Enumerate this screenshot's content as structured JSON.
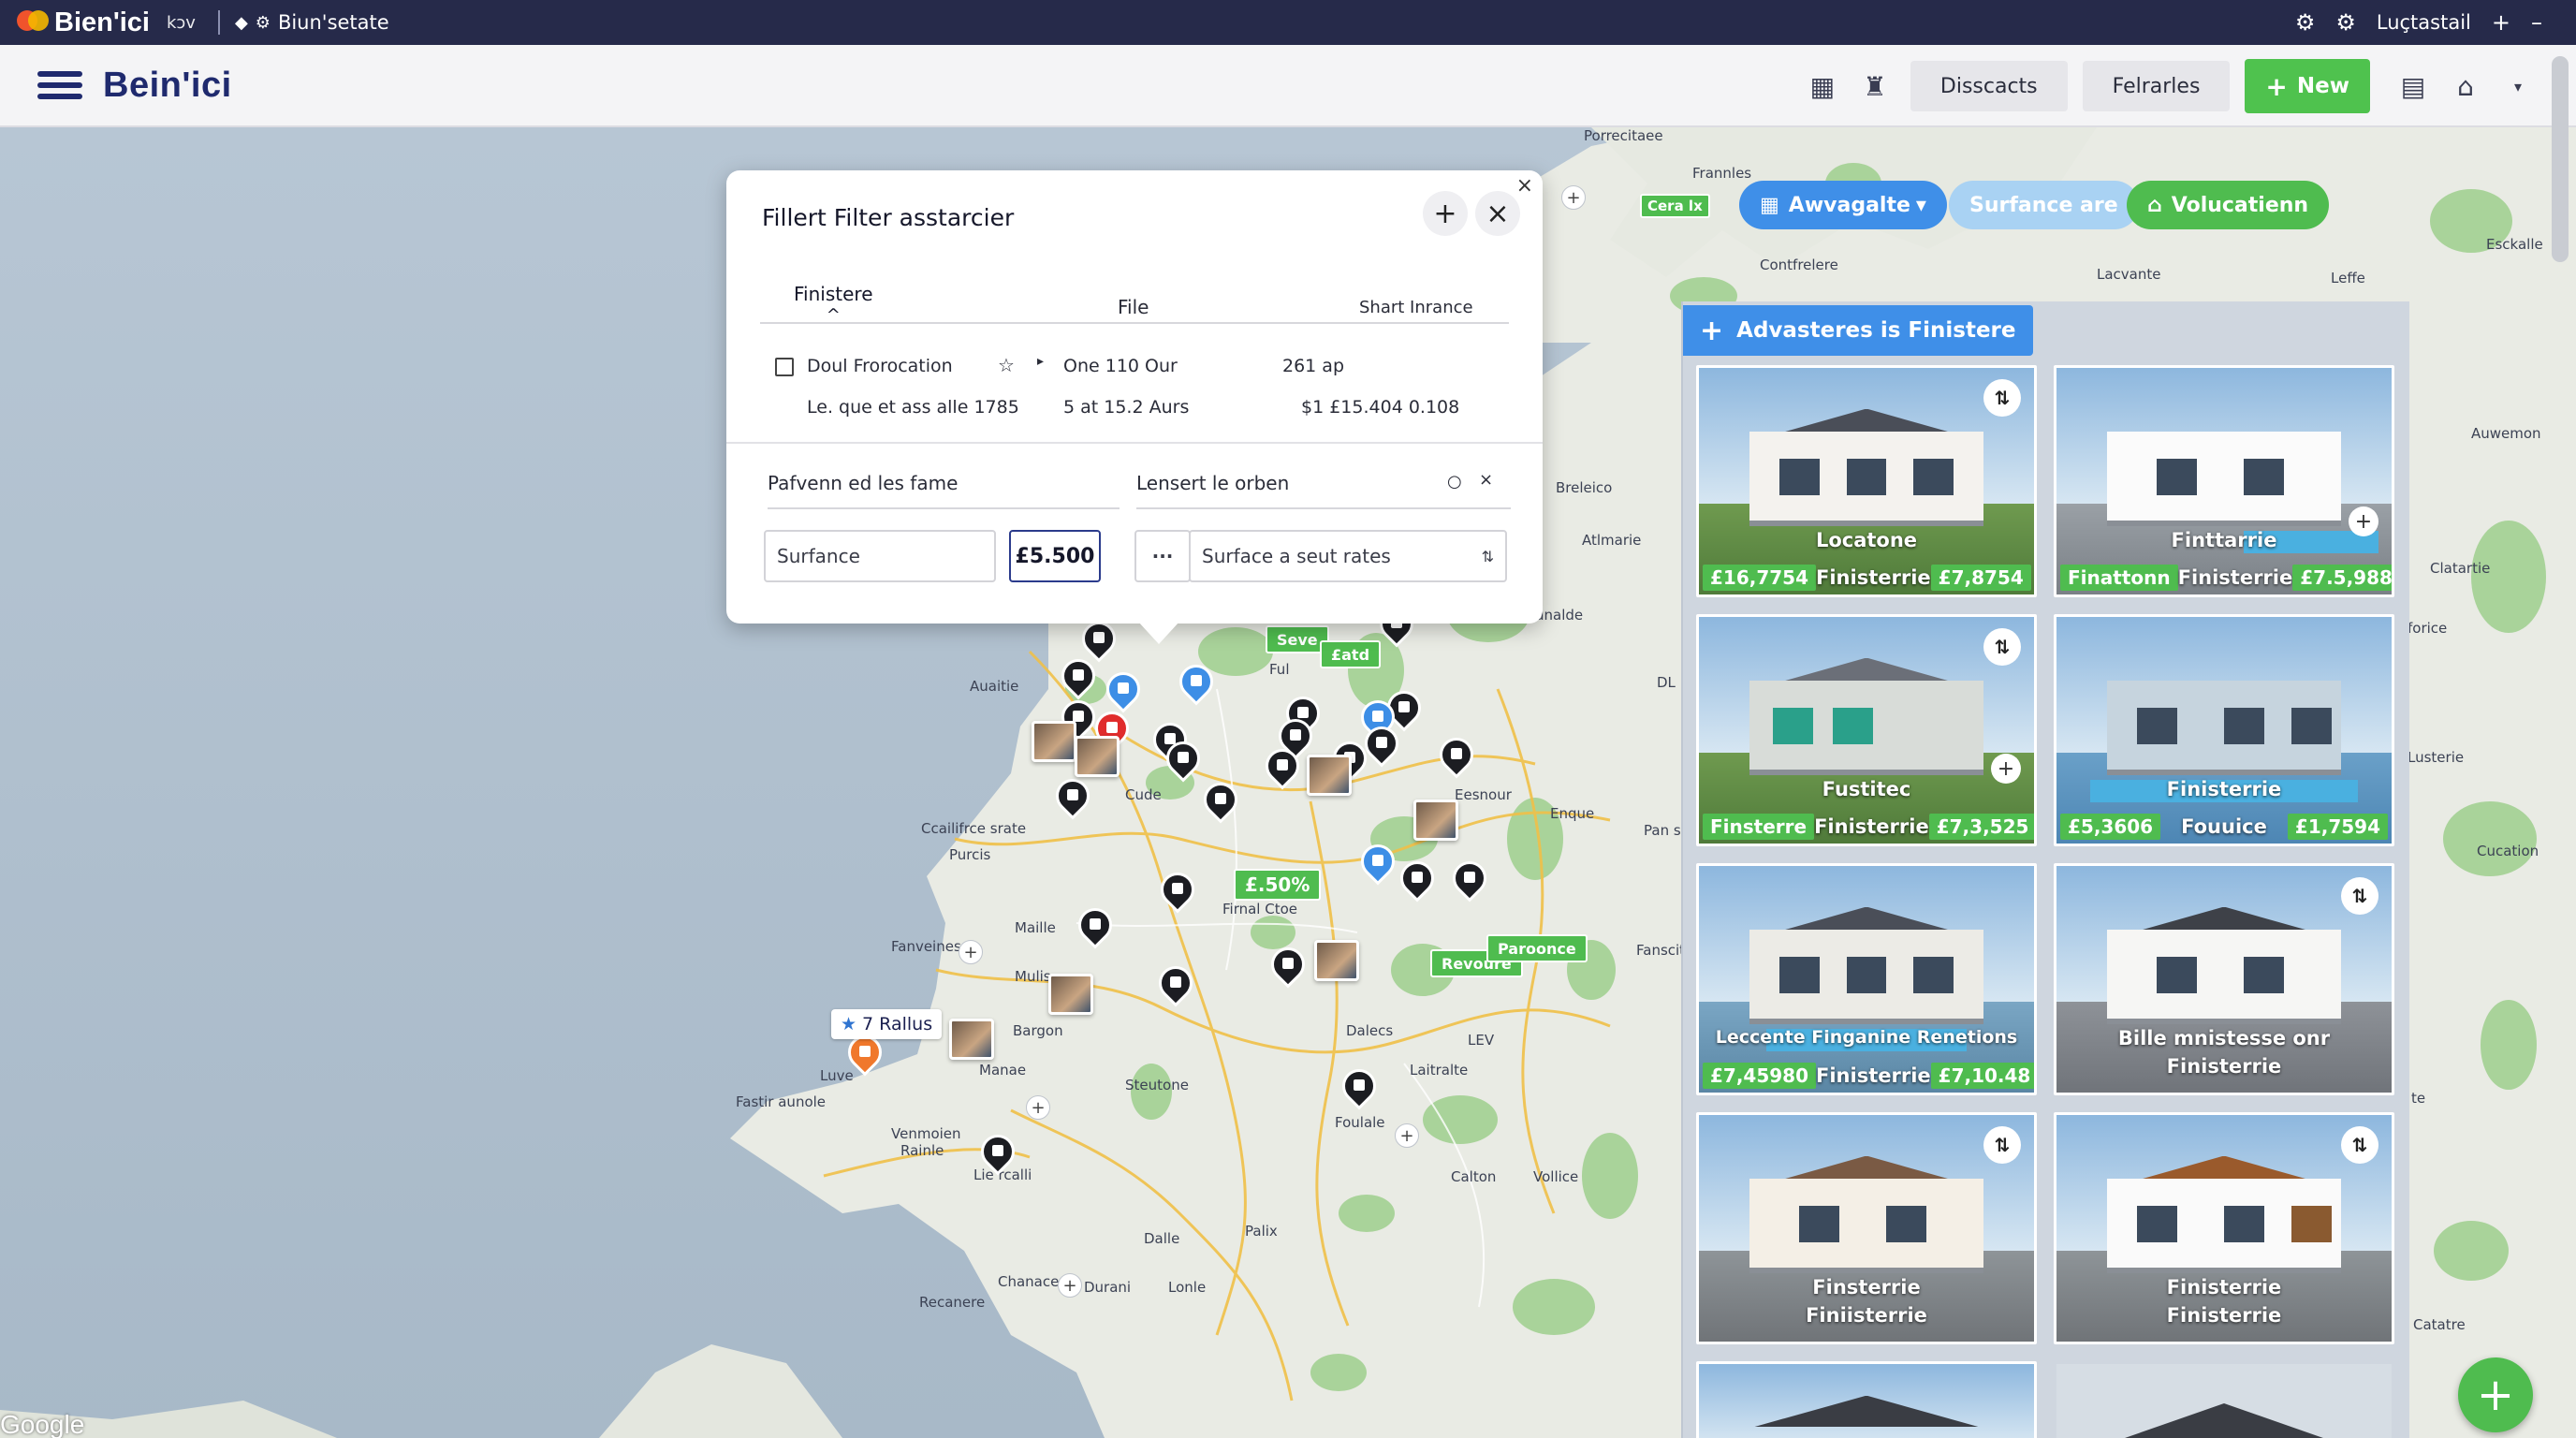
{
  "topbar": {
    "app": "Bien'ici",
    "kbd": "kↄv",
    "extension": "Biun'setate",
    "user": "Luçtastail"
  },
  "header": {
    "brand": "Bein'ici",
    "discounts_label": "Disscacts",
    "features_label": "Felrarles",
    "new_label": "New"
  },
  "chips": {
    "availability": "Awvagalte",
    "surface": "Surfance are",
    "vacation": "Volucatienn",
    "cera": "Cera lx"
  },
  "popup": {
    "title": "Fillert Filter asstarcier",
    "tab_active": "Finistere",
    "tab_file": "File",
    "tab_short": "Shart Inrance",
    "row1_col1": "Doul Frorocation",
    "row1_col2": "One 110 Our",
    "row1_col3": "261 ap",
    "row2_col1": "Le. que et ass alle 1785",
    "row2_col2": "5 at 15.2 Aurs",
    "row2_col3": "$1 £15.404 0.108",
    "field_left_label": "Pafvenn ed les fame",
    "field_right_label": "Lensert le orben",
    "input_surface": "Surfance",
    "input_value": "£5.500",
    "input_more": "···",
    "input_rates": "Surface a seut rates"
  },
  "map": {
    "labels": {
      "porrecitaee": "Porrecitaee",
      "frannles": "Frannles",
      "contfrelere": "Contfrelere",
      "lacvante": "Lacvante",
      "leffe": "Leffe",
      "esckalle": "Esckalle",
      "auwemon": "Auwemon",
      "breleico": "Breleico",
      "atlmarie": "Atlmarie",
      "unalde": "unalde",
      "clatartie": "Clatartie",
      "forice": "forice",
      "lusterie": "Lusterie",
      "cucation": "Cucation",
      "auaitie": "Auaitie",
      "cude": "Cude",
      "esnour": "Eesnour",
      "enque": "Enque",
      "pans": "Pan s",
      "dl": "DL",
      "ccailifrce": "Ccailifrce srate",
      "purcis": "Purcis",
      "firnal": "Firnal Ctoe",
      "maille": "Maille",
      "fanveines": "Fanveines",
      "fanscit": "Fanscit",
      "mulis": "Mulis",
      "bargon": "Bargon",
      "manae": "Manae",
      "dalecs": "Dalecs",
      "lev": "LEV",
      "laitralte": "Laitralte",
      "steutone": "Steutone",
      "luve": "Luve",
      "fastiraunale": "Fastir aunole",
      "venmoien": "Venmoien",
      "rainle": "Rainle",
      "lieravalli": "Lie rcalli",
      "foulale": "Foulale",
      "calton": "Calton",
      "vollice": "Vollice",
      "dalle": "Dalle",
      "palix": "Palix",
      "chanace": "Chanace",
      "durani": "Durani",
      "lonle": "Lonle",
      "recanere": "Recanere",
      "fuil": "Ful",
      "te": "te",
      "catatre": "Catatre"
    },
    "tags": {
      "seve": "Seve",
      "ealrd": "£atd",
      "pct": "£.50%",
      "revoure": "Revoure",
      "paroonce": "Paroonce"
    },
    "rallus": "7 Rallus",
    "attribution": "Google"
  },
  "panel": {
    "title": "Advasteres is Finistere",
    "cards": [
      {
        "title": "Locatone",
        "place": "Finisterrie",
        "price_left": "£16,7754",
        "price_right": "£7,8754"
      },
      {
        "title": "Finttarrie",
        "place": "Finisterrie",
        "price_left": "Finattonn",
        "price_right": "£7.5,988"
      },
      {
        "title": "Fustitec",
        "place": "Finisterrie",
        "price_left": "Finsterre",
        "price_right": "£7,3,525"
      },
      {
        "title": "Finisterrie",
        "place": "Fouuice",
        "price_left": "£5,3606",
        "price_right": "£1,7594"
      },
      {
        "title": "Leccente Finganine Renetions",
        "place": "Finisterrie",
        "price_left": "£7,45980",
        "price_right": "£7,10.48"
      },
      {
        "title": "Bille mnistesse onr",
        "place": "Finisterrie",
        "price_left": "",
        "price_right": ""
      },
      {
        "title": "Finsterrie",
        "place": "Finiisterrie",
        "price_left": "",
        "price_right": ""
      },
      {
        "title": "Finisterrie",
        "place": "Finisterrie",
        "price_left": "",
        "price_right": ""
      }
    ]
  },
  "colors": {
    "topbar": "#262a4a",
    "brand": "#1f2a6e",
    "accent_green": "#4fbc4f",
    "accent_blue": "#3f8fe8",
    "sea": "#b9c7d3",
    "land": "#e9ebe4"
  }
}
